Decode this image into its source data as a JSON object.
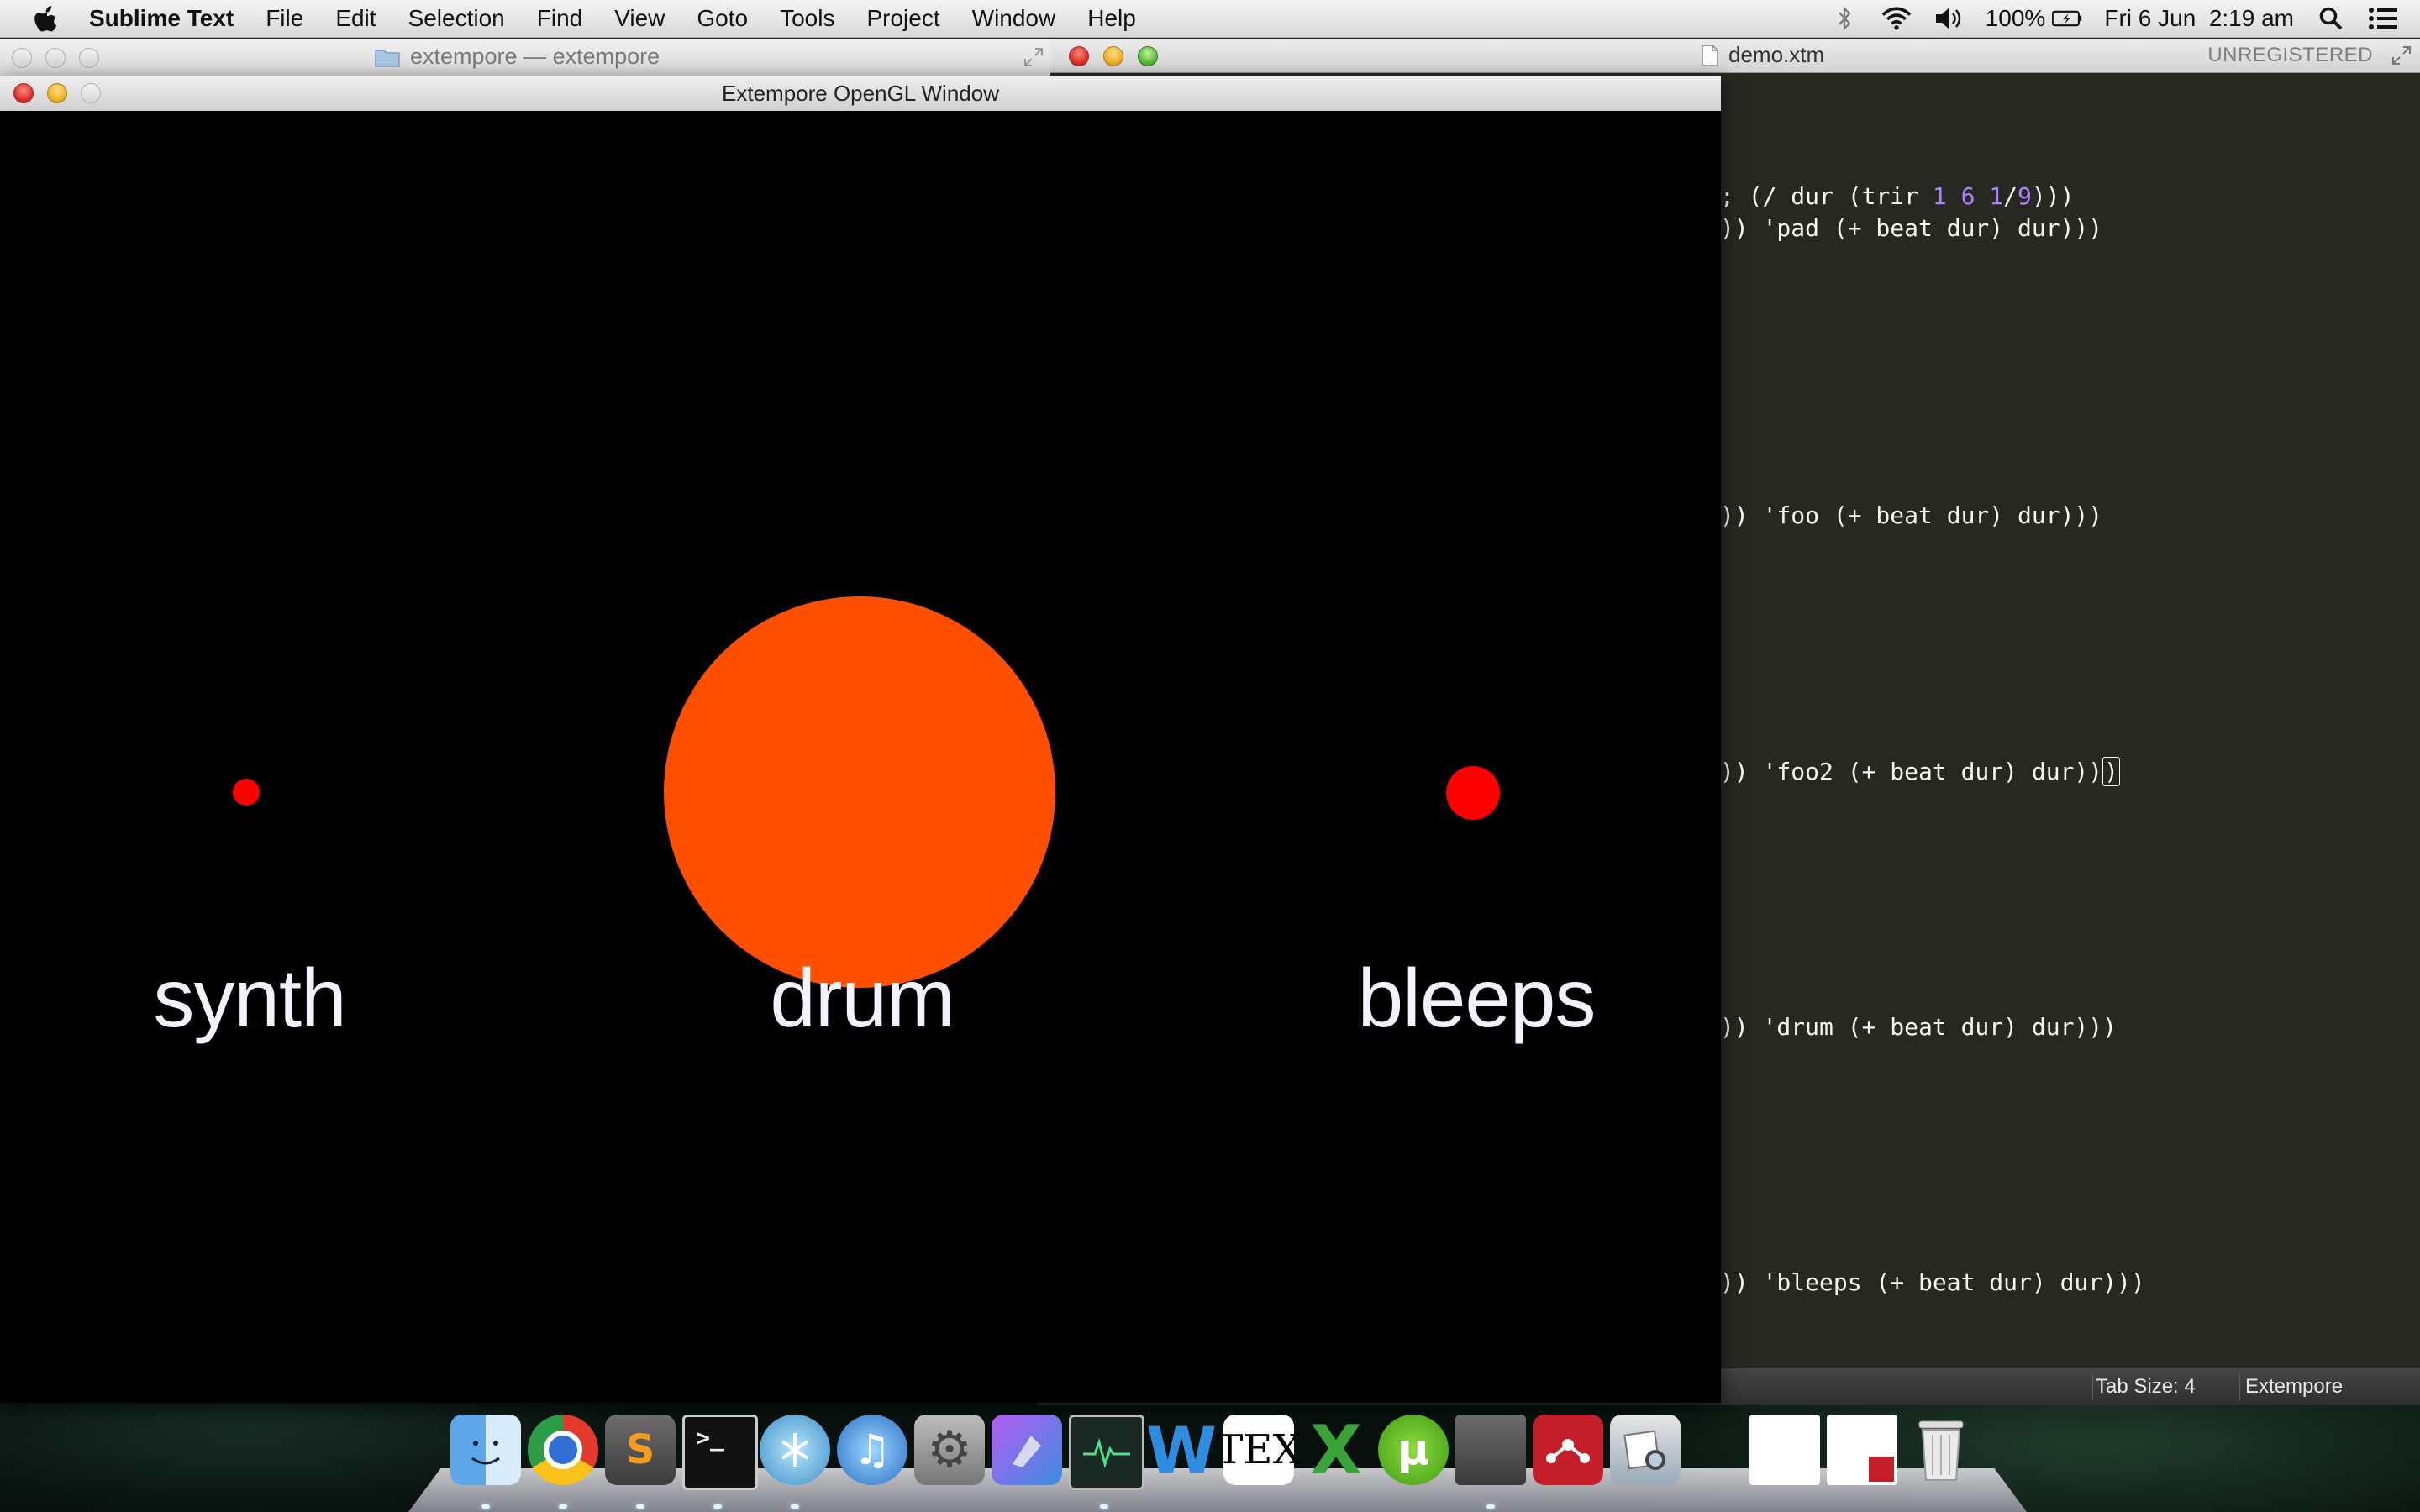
{
  "menubar": {
    "app_name": "Sublime Text",
    "menus": [
      "File",
      "Edit",
      "Selection",
      "Find",
      "View",
      "Goto",
      "Tools",
      "Project",
      "Window",
      "Help"
    ],
    "battery": "100%",
    "clock": "Fri 6 Jun  2:19 am",
    "status_icons": [
      "bluetooth-icon",
      "wifi-icon",
      "volume-icon",
      "battery-icon",
      "spotlight-icon",
      "notification-center-icon"
    ]
  },
  "finder_window": {
    "title": "extempore — extempore"
  },
  "gl_window": {
    "title": "Extempore OpenGL Window",
    "voices": [
      {
        "label": "synth",
        "color": "#ff0000"
      },
      {
        "label": "drum",
        "color": "#ff4f00"
      },
      {
        "label": "bleeps",
        "color": "#ff0000"
      }
    ]
  },
  "sublime_window": {
    "file_name": "demo.xtm",
    "license_label": "UNREGISTERED",
    "code_lines": [
      {
        "pre": "; (/ dur (trir ",
        "nums": [
          "1",
          "6",
          "1"
        ],
        "sep": "/",
        "num2": "9",
        "post": ")))"
      },
      {
        "text": ")) 'pad (+ beat dur) dur)))"
      },
      {
        "text": ")) 'foo (+ beat dur) dur)))"
      },
      {
        "text": ")) 'foo2 (+ beat dur) dur))",
        "cursor": ")"
      },
      {
        "text": ")) 'drum (+ beat dur) dur)))"
      },
      {
        "text": ")) 'bleeps (+ beat dur) dur)))"
      }
    ],
    "status": {
      "tab_size": "Tab Size: 4",
      "syntax": "Extempore"
    }
  },
  "dock": {
    "apps": [
      "Finder",
      "Chrome",
      "Sublime Text",
      "Terminal",
      "Extempore",
      "iTunes",
      "System Preferences",
      "Instruments",
      "Activity Monitor",
      "Word",
      "TeXShop",
      "Excel",
      "uTorrent",
      "Window",
      "Mendeley",
      "Preview",
      "Document",
      "Document",
      "Trash"
    ]
  }
}
